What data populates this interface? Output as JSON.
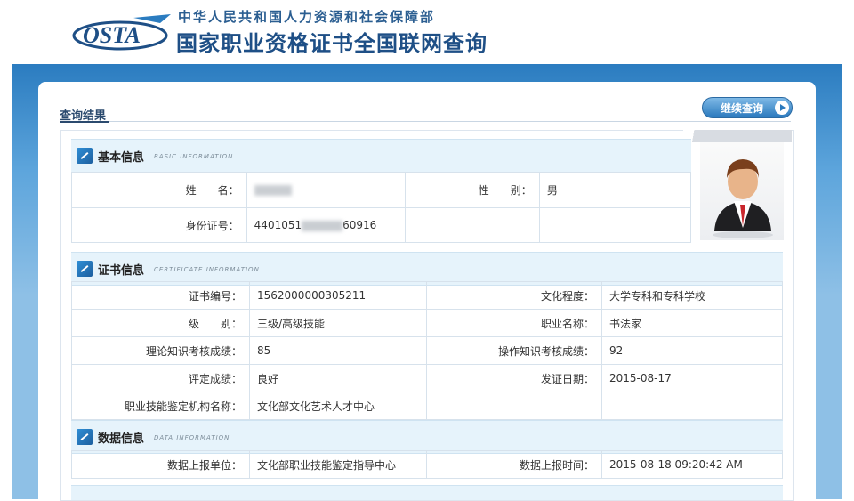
{
  "header": {
    "logo_text": "OSTA",
    "org_name": "中华人民共和国人力资源和社会保障部",
    "site_title": "国家职业资格证书全国联网查询"
  },
  "panel": {
    "title": "查询结果",
    "continue_label": "继续查询"
  },
  "basic": {
    "title": "基本信息",
    "subtitle": "BASIC INFORMATION",
    "name_label": "姓　　名：",
    "gender_label": "性　　别：",
    "gender_value": "男",
    "id_label": "身份证号：",
    "id_prefix": "4401051",
    "id_suffix": "60916"
  },
  "certificate": {
    "title": "证书信息",
    "subtitle": "CERTIFICATE INFORMATION",
    "rows": [
      {
        "l1": "证书编号：",
        "v1": "1562000000305211",
        "l2": "文化程度：",
        "v2": "大学专科和专科学校"
      },
      {
        "l1": "级　　别：",
        "v1": "三级/高级技能",
        "l2": "职业名称：",
        "v2": "书法家"
      },
      {
        "l1": "理论知识考核成绩：",
        "v1": "85",
        "l2": "操作知识考核成绩：",
        "v2": "92"
      },
      {
        "l1": "评定成绩：",
        "v1": "良好",
        "l2": "发证日期：",
        "v2": "2015-08-17"
      },
      {
        "l1": "职业技能鉴定机构名称：",
        "v1": "文化部文化艺术人才中心",
        "l2": "",
        "v2": ""
      }
    ]
  },
  "data_info": {
    "title": "数据信息",
    "subtitle": "DATA INFORMATION",
    "unit_label": "数据上报单位：",
    "unit_value": "文化部职业技能鉴定指导中心",
    "time_label": "数据上报时间：",
    "time_value": "2015-08-18 09:20:42 AM"
  },
  "colors": {
    "brand_blue": "#1e4f86",
    "band_blue": "#2b7cc0",
    "section_bg": "#e6f3fb"
  }
}
